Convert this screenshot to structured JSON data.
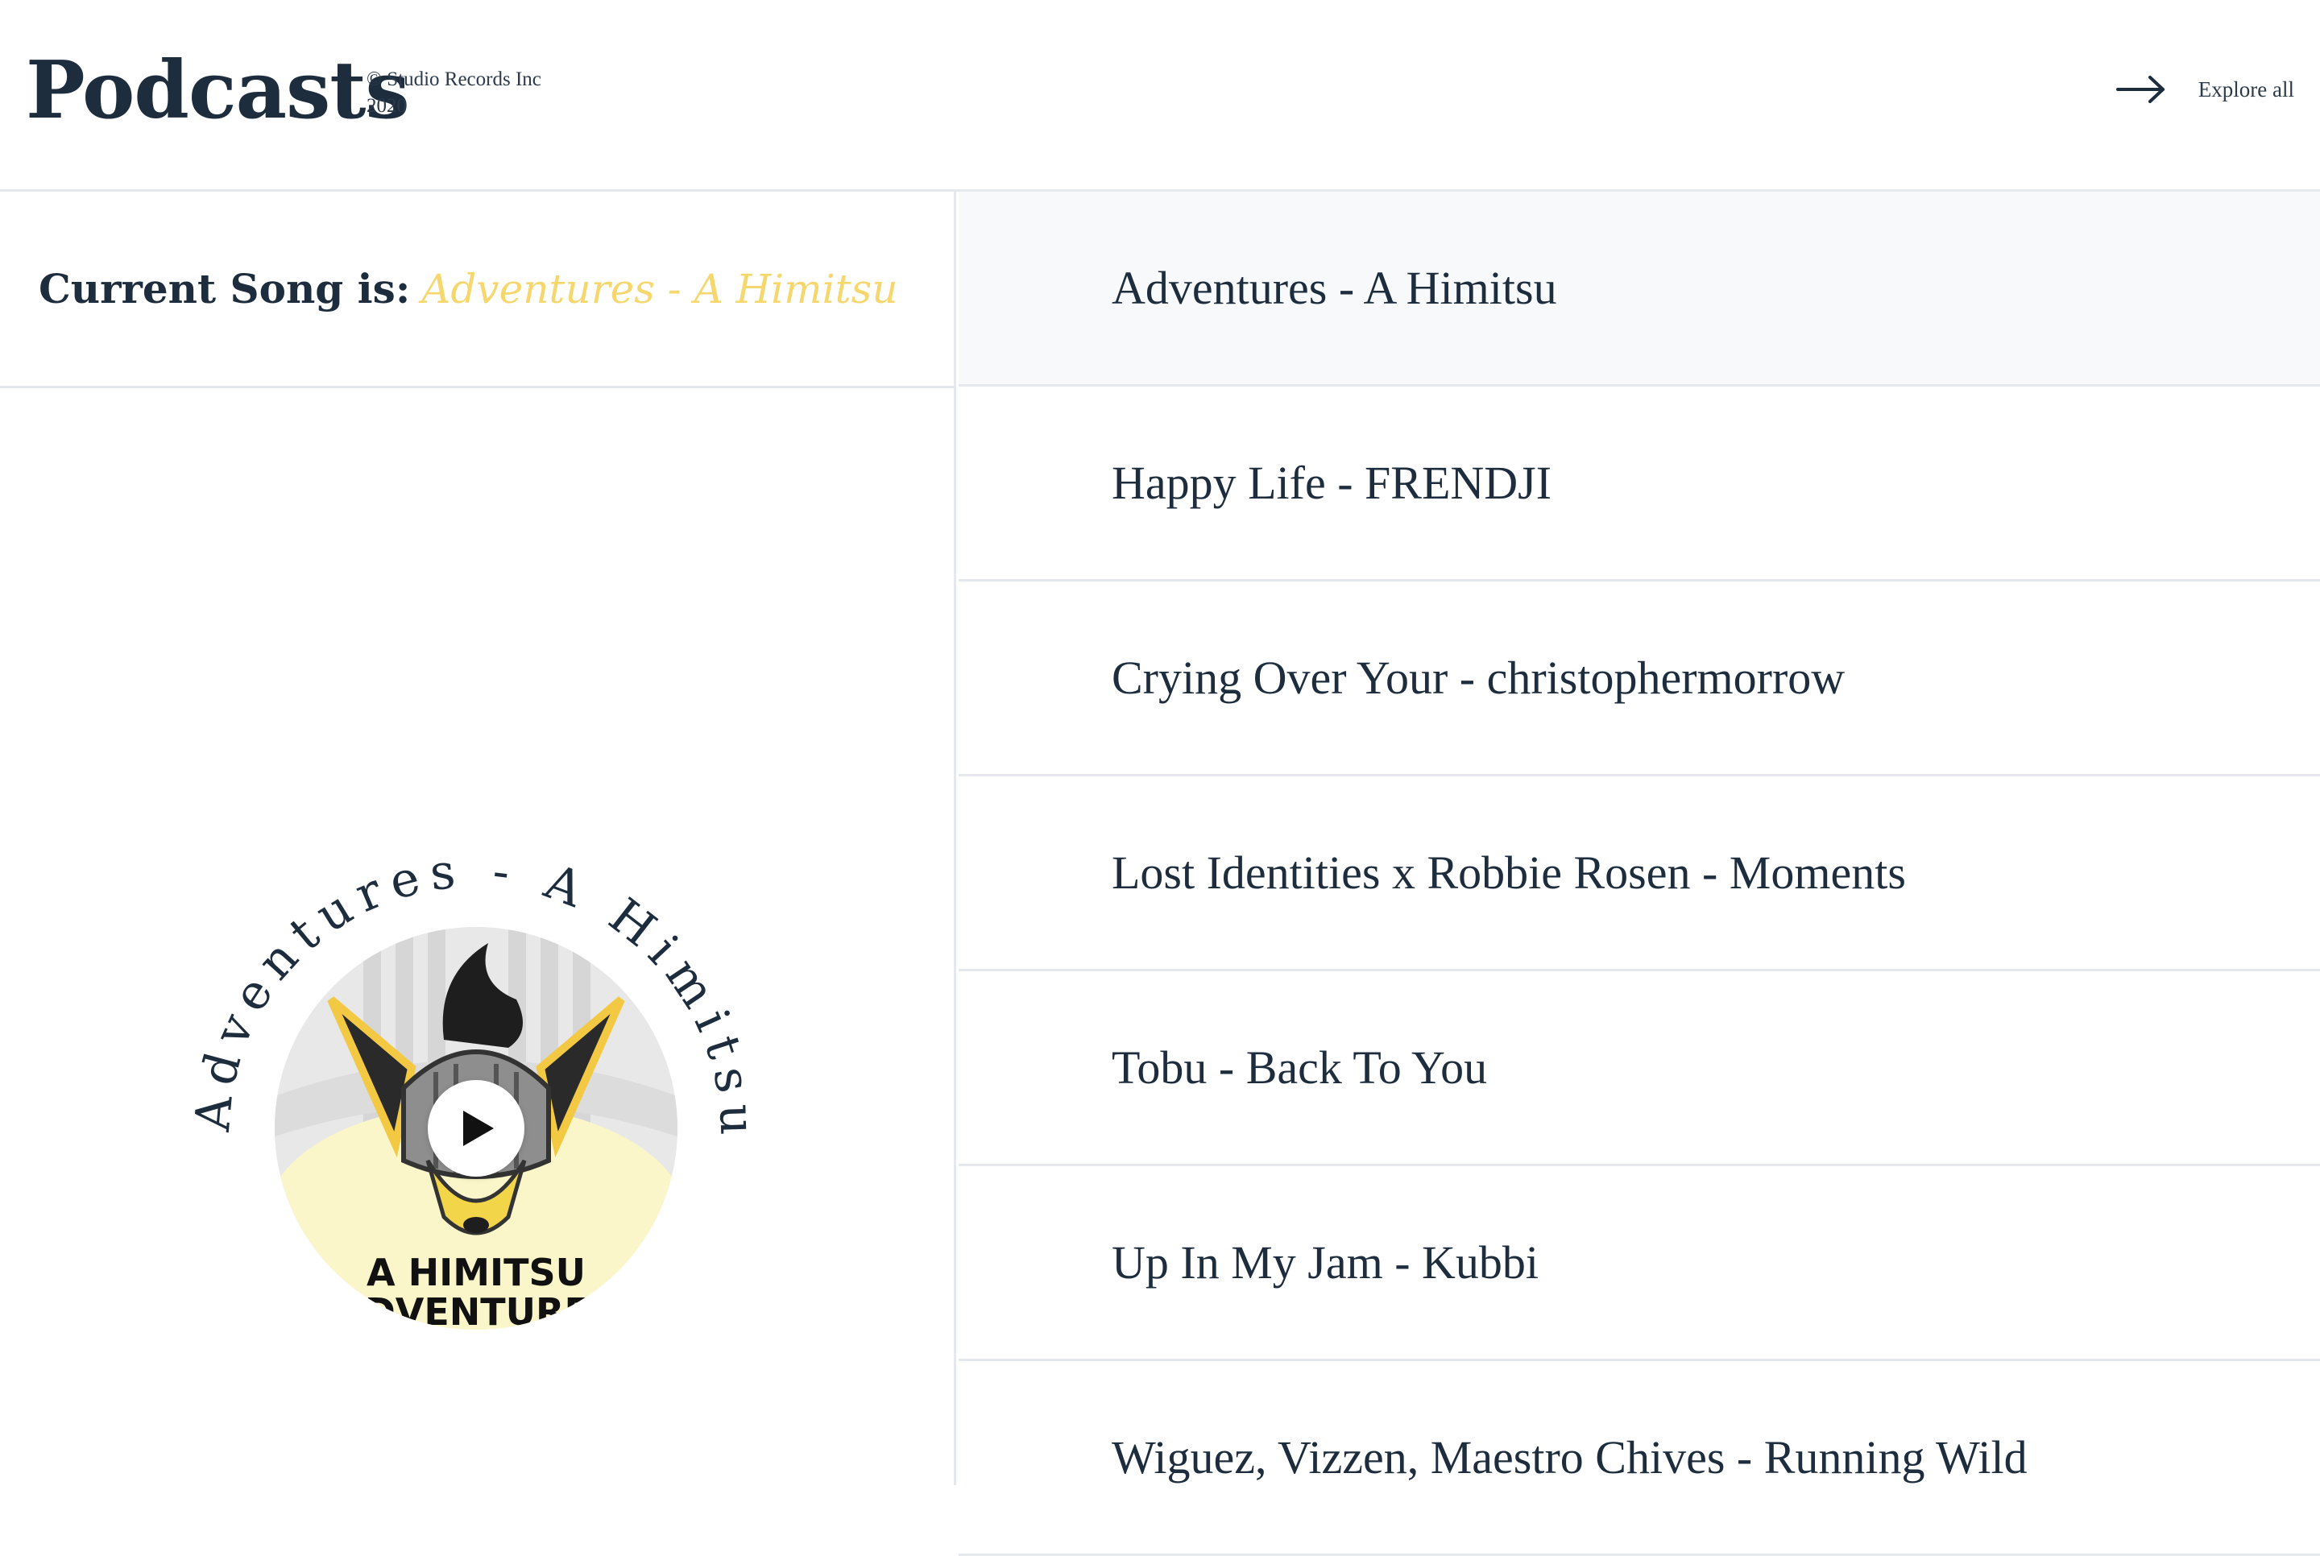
{
  "header": {
    "title": "Podcasts",
    "copyright": "© Studio Records Inc 2020",
    "explore_label": "Explore all",
    "explore_icon": "arrow-right-icon"
  },
  "player": {
    "label": "Current Song is:",
    "current_song": "Adventures - A Himitsu",
    "circular_text": "Adventures - A Himitsu",
    "cover_text_line1": "A HIMITSU",
    "cover_text_line2": "ADVENTURES",
    "play_icon": "play-icon",
    "accent_color": "#f5d76e"
  },
  "playlist": [
    {
      "title": "Adventures - A Himitsu",
      "active": true
    },
    {
      "title": "Happy Life - FRENDJI"
    },
    {
      "title": "Crying Over Your - christophermorrow"
    },
    {
      "title": "Lost Identities x Robbie Rosen - Moments"
    },
    {
      "title": "Tobu - Back To You"
    },
    {
      "title": "Up In My Jam - Kubbi"
    },
    {
      "title": "Wiguez, Vizzen, Maestro Chives - Running Wild"
    }
  ]
}
